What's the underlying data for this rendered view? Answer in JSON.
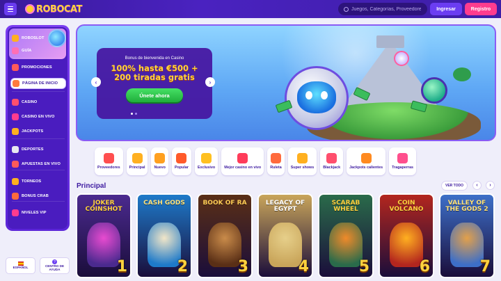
{
  "header": {
    "logo_text": "ROBOCAT",
    "search_placeholder": "Juegos, Categorías, Proveedores",
    "login_label": "Ingresar",
    "register_label": "Registro"
  },
  "sidebar": {
    "items": [
      {
        "label": "ROBOSLOT",
        "icon": "robot-coin-icon",
        "color": "#ffb020"
      },
      {
        "label": "GUÍA",
        "icon": "book-icon",
        "color": "#ff6fb5"
      },
      {
        "label": "PROMOCIONES",
        "icon": "gift-icon",
        "color": "#ff5a5a"
      },
      {
        "label": "PÁGINA DE INICIO",
        "icon": "home-icon",
        "color": "#ff7a3d"
      },
      {
        "label": "CASINO",
        "icon": "dice-icon",
        "color": "#ff4f6d"
      },
      {
        "label": "CASINO EN VIVO",
        "icon": "cards-icon",
        "color": "#ff3c8e"
      },
      {
        "label": "JACKPOTS",
        "icon": "jackpot-icon",
        "color": "#ffb020"
      },
      {
        "label": "DEPORTES",
        "icon": "ball-icon",
        "color": "#e8e8f0"
      },
      {
        "label": "APUESTAS EN VIVO",
        "icon": "live-ball-icon",
        "color": "#ff5a5a"
      },
      {
        "label": "TORNEOS",
        "icon": "trophy-icon",
        "color": "#ffb020"
      },
      {
        "label": "BONUS CRAB",
        "icon": "crab-icon",
        "color": "#ff6a3d"
      },
      {
        "label": "NIVELES VIP",
        "icon": "vip-icon",
        "color": "#ff3c8e"
      }
    ],
    "language_label": "ESPAÑOL",
    "help_label": "CENTRO DE AYUDA"
  },
  "banner": {
    "subtitle": "Bonus de bienvenida en Casino",
    "title_line1": "100% hasta €500 +",
    "title_line2": "200 tiradas gratis",
    "cta_label": "Únete ahora"
  },
  "categories": [
    {
      "label": "Proveedores",
      "icon": "providers-icon",
      "color": "#ff4f4f"
    },
    {
      "label": "Principal",
      "icon": "medal-icon",
      "color": "#ffb020"
    },
    {
      "label": "Nuevo",
      "icon": "bell-icon",
      "color": "#ffa020"
    },
    {
      "label": "Popular",
      "icon": "star-icon",
      "color": "#ff5a2a"
    },
    {
      "label": "Exclusivo",
      "icon": "chest-icon",
      "color": "#ffc020"
    },
    {
      "label": "Mejor casino en vivo",
      "icon": "roulette-icon",
      "color": "#ff3c5a"
    },
    {
      "label": "Ruleta",
      "icon": "wheel-icon",
      "color": "#ff6a3d"
    },
    {
      "label": "Super shows",
      "icon": "show-icon",
      "color": "#ffb020"
    },
    {
      "label": "Blackjack",
      "icon": "blackjack-icon",
      "color": "#ff4f6d"
    },
    {
      "label": "Jackpots calientes",
      "icon": "hot-jackpot-icon",
      "color": "#ff8a20"
    },
    {
      "label": "Tragaperras",
      "icon": "slot-icon",
      "color": "#ff4f8d"
    }
  ],
  "section": {
    "title": "Principal",
    "view_all_label": "VER TODO"
  },
  "games": [
    {
      "name": "JOKER COINSHOT",
      "rank": "1",
      "bg": "#4b2a8f",
      "art": "#e84bd0",
      "name_color": "#ffd23e"
    },
    {
      "name": "CASH GODS",
      "rank": "2",
      "bg": "#1e7ac9",
      "art": "#f2e6c8",
      "name_color": "#ffe27a"
    },
    {
      "name": "BOOK OF RA",
      "rank": "3",
      "bg": "#5a2f16",
      "art": "#c98b4a",
      "name_color": "#ffcc55"
    },
    {
      "name": "LEGACY OF EGYPT",
      "rank": "4",
      "bg": "#c9a55a",
      "art": "#e6cf8a",
      "name_color": "#ffffff"
    },
    {
      "name": "SCARAB WHEEL",
      "rank": "5",
      "bg": "#2a6b4a",
      "art": "#f08a2a",
      "name_color": "#ffd23e"
    },
    {
      "name": "COIN VOLCANO",
      "rank": "6",
      "bg": "#b3261e",
      "art": "#ffb020",
      "name_color": "#ffd23e"
    },
    {
      "name": "VALLEY OF THE GODS 2",
      "rank": "7",
      "bg": "#3d6fc8",
      "art": "#e3a04a",
      "name_color": "#ffe27a"
    }
  ]
}
